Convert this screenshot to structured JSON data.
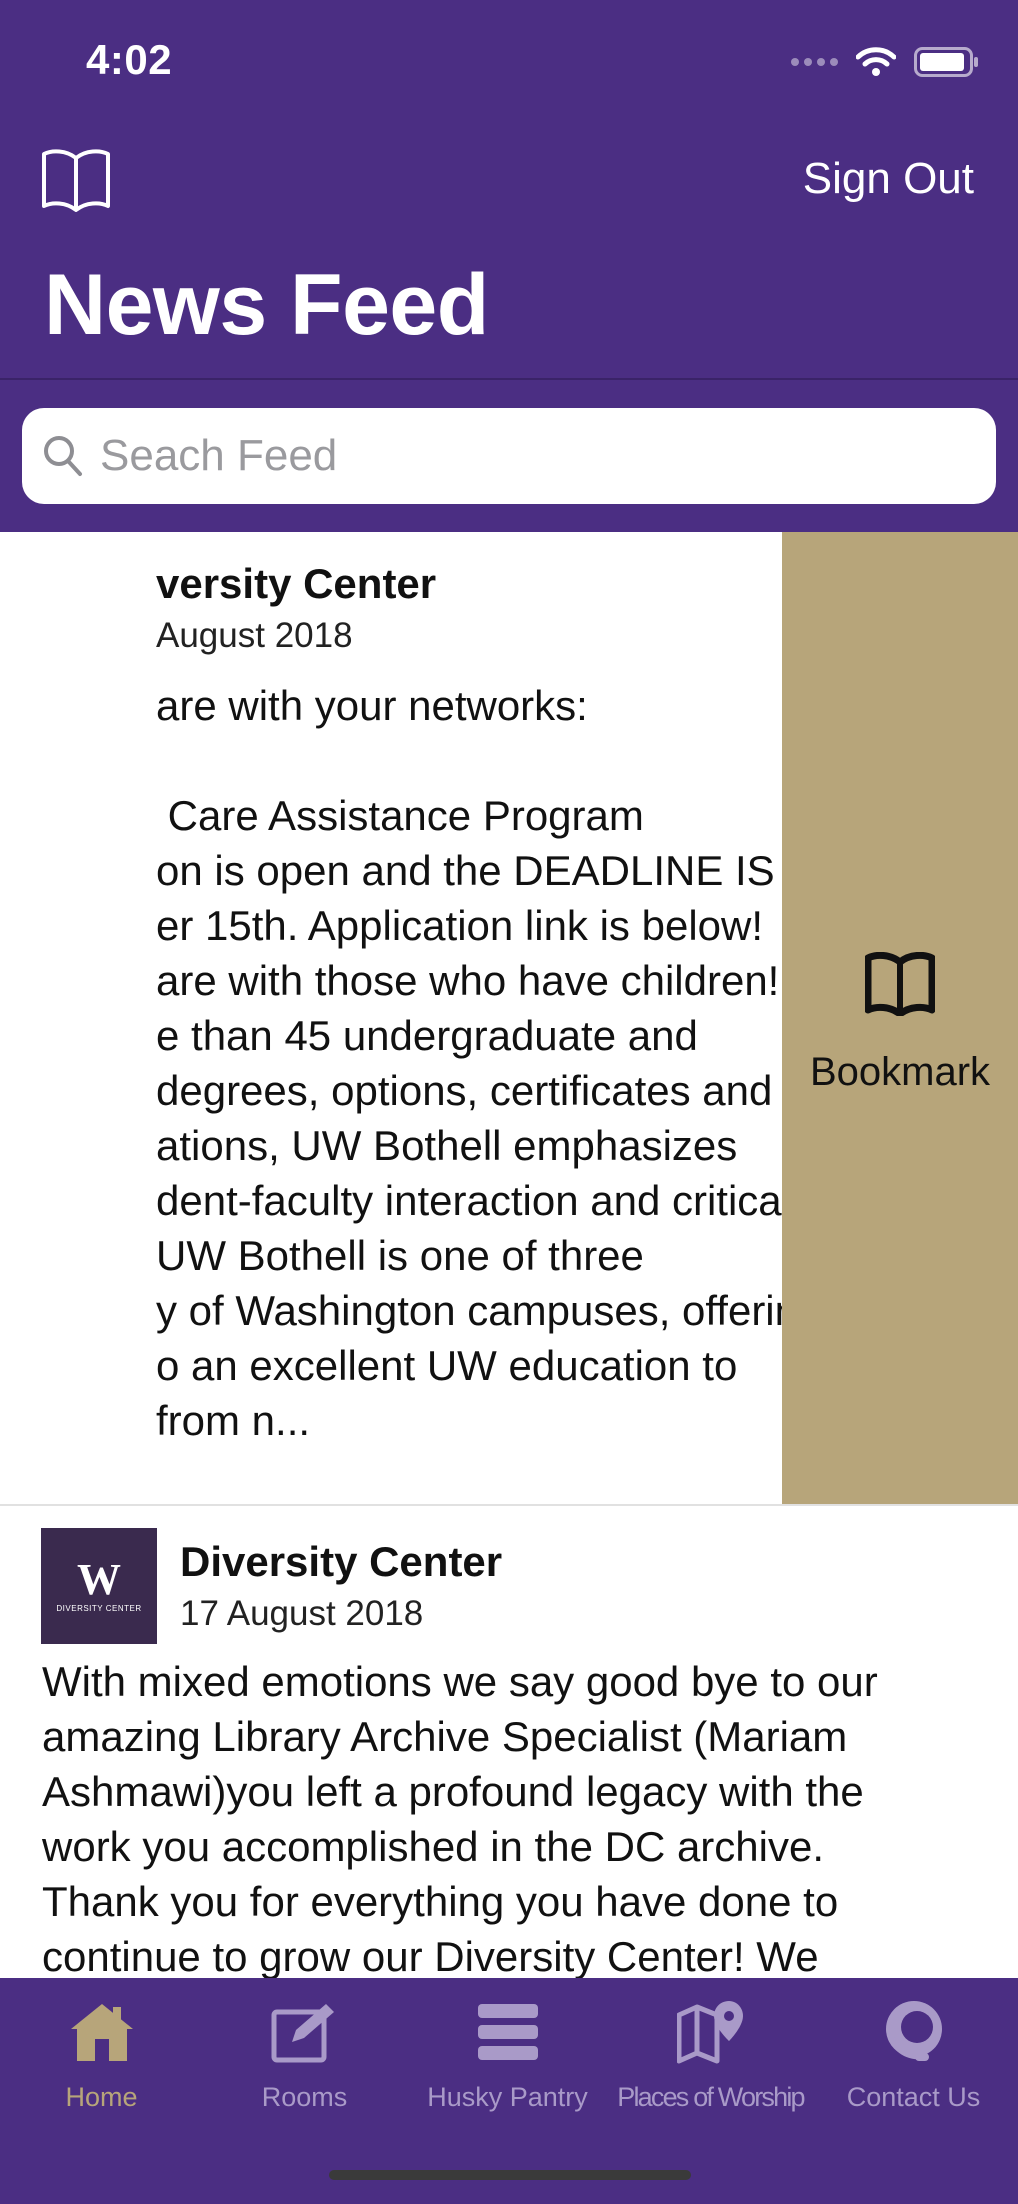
{
  "status_bar": {
    "time": "4:02"
  },
  "header": {
    "sign_out_label": "Sign Out",
    "title": "News Feed",
    "bookmarks_icon": "book-open-icon"
  },
  "search": {
    "placeholder": "Seach Feed",
    "value": "",
    "icon": "search-icon"
  },
  "feed": {
    "posts": [
      {
        "org": "versity Center",
        "date": "August 2018",
        "body": "are with your networks:\n\n Care Assistance Program\non is open and the DEADLINE IS\ner 15th. Application link is below!\nare with those who have children!\ne than 45 undergraduate and\ndegrees, options, certificates and\nations, UW Bothell emphasizes\ndent-faculty interaction and critical\nUW Bothell is one of three\ny of Washington campuses, offering\no an excellent UW education to\nfrom n...",
        "swipe_action": {
          "label": "Bookmark",
          "icon": "book-open-icon",
          "color": "#b7a57a"
        }
      },
      {
        "org": "Diversity Center",
        "date": "17 August 2018",
        "avatar": {
          "letter": "W",
          "subtitle": "DIVERSITY CENTER"
        },
        "body": "With mixed emotions we say good bye to our\namazing Library Archive Specialist (Mariam\nAshmawi)you left a profound legacy with the\nwork you accomplished in the DC archive.\nThank you for everything you have done to\ncontinue to grow our Diversity Center! We"
      }
    ]
  },
  "tab_bar": {
    "tabs": [
      {
        "label": "Home",
        "icon": "home-icon",
        "active": true
      },
      {
        "label": "Rooms",
        "icon": "edit-icon",
        "active": false
      },
      {
        "label": "Husky Pantry",
        "icon": "stack-icon",
        "active": false
      },
      {
        "label": "Places of Worship",
        "icon": "map-pin-icon",
        "active": false
      },
      {
        "label": "Contact Us",
        "icon": "headset-icon",
        "active": false
      }
    ]
  },
  "colors": {
    "brand_purple": "#4b2e83",
    "gold": "#b7a57a",
    "inactive_tab": "#a99ac8"
  }
}
